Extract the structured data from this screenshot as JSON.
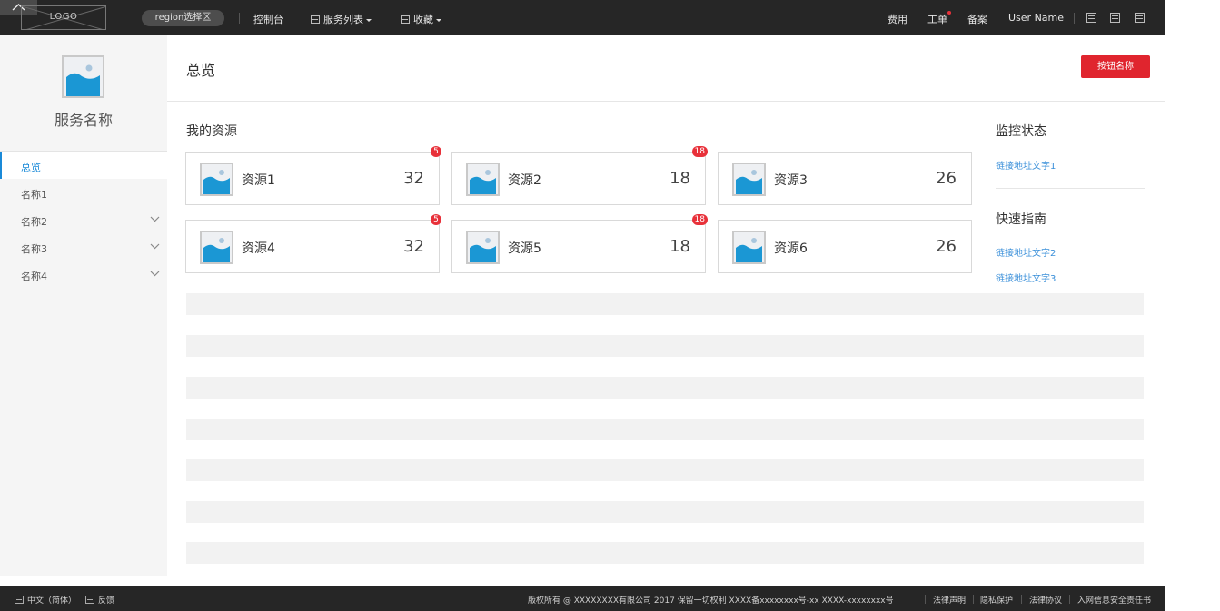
{
  "topbar": {
    "logo": "LOGO",
    "region": "region选择区",
    "console": "控制台",
    "services": "服务列表",
    "favorites": "收藏",
    "right_links": [
      "费用",
      "工单",
      "备案"
    ],
    "user_name": "User  Name"
  },
  "sidebar": {
    "service_name": "服务名称",
    "items": [
      {
        "label": "总览",
        "active": true
      },
      {
        "label": "名称1"
      },
      {
        "label": "名称2",
        "expandable": true
      },
      {
        "label": "名称3",
        "expandable": true
      },
      {
        "label": "名称4",
        "expandable": true
      }
    ]
  },
  "main": {
    "title": "总览",
    "button": "按钮名称",
    "resources_title": "我的资源",
    "cards": [
      {
        "name": "资源1",
        "count": "32",
        "badge": "5"
      },
      {
        "name": "资源2",
        "count": "18",
        "badge": "18"
      },
      {
        "name": "资源3",
        "count": "26"
      },
      {
        "name": "资源4",
        "count": "32",
        "badge": "5"
      },
      {
        "name": "资源5",
        "count": "18",
        "badge": "18"
      },
      {
        "name": "资源6",
        "count": "26"
      }
    ],
    "monitor_title": "监控状态",
    "monitor_link": "链接地址文字1",
    "guide_title": "快速指南",
    "guide_links": [
      "链接地址文字2",
      "链接地址文字3"
    ]
  },
  "footer": {
    "language": "中文（简体）",
    "feedback": "反馈",
    "copyright": "版权所有 @ XXXXXXXX有限公司  2017  保留一切权利  XXXX备xxxxxxxx号-xx   XXXX-xxxxxxxx号",
    "links": [
      "法律声明",
      "隐私保护",
      "法律协议",
      "入网信息安全责任书"
    ]
  },
  "colors": {
    "topbar_bg": "#262626",
    "accent_blue": "#1a8ad8",
    "button_red": "#e0252e",
    "badge_red": "#e8313a"
  }
}
